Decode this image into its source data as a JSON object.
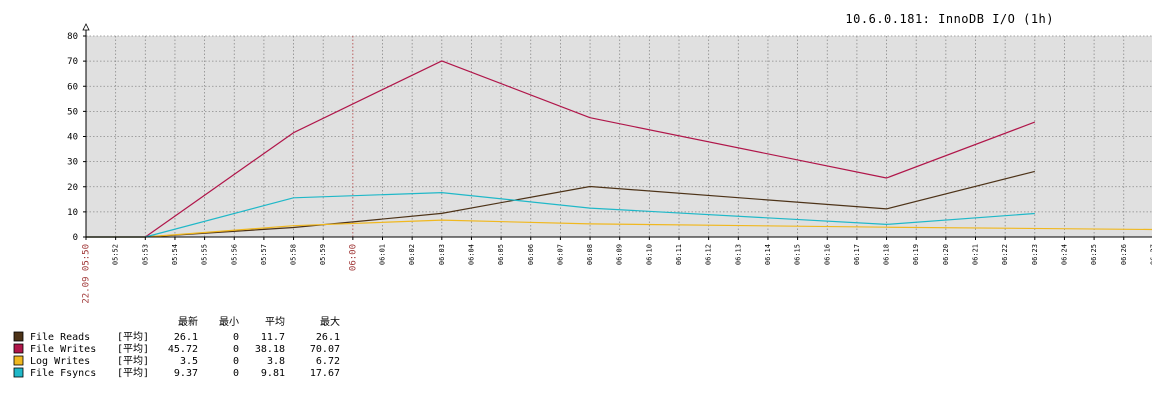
{
  "chart_data": {
    "type": "line",
    "title": "10.6.0.181: InnoDB I/O (1h)",
    "ylim": [
      0,
      80
    ],
    "y_ticks": [
      0,
      10,
      20,
      30,
      40,
      50,
      60,
      70,
      80
    ],
    "x_ticks": [
      "22.09 05:50",
      "05:52",
      "05:53",
      "05:54",
      "05:55",
      "05:56",
      "05:57",
      "05:58",
      "05:59",
      "06:00",
      "06:01",
      "06:02",
      "06:03",
      "06:04",
      "06:05",
      "06:06",
      "06:07",
      "06:08",
      "06:09",
      "06:10",
      "06:11",
      "06:12",
      "06:13",
      "06:14",
      "06:15",
      "06:16",
      "06:17",
      "06:18",
      "06:19",
      "06:20",
      "06:21",
      "06:22",
      "06:23",
      "06:24",
      "06:25",
      "06:26",
      "06:27"
    ],
    "highlight_ticks": [
      "22.09 05:50",
      "06:00"
    ],
    "grid": true,
    "background": "#e0e0e0",
    "series": [
      {
        "name": "File Reads",
        "color": "#4d3318",
        "x": [
          "05:50",
          "05:53",
          "05:58",
          "06:03",
          "06:08",
          "06:18",
          "06:23"
        ],
        "values": [
          0,
          0,
          3.8,
          9.4,
          20.1,
          11.2,
          26.1
        ]
      },
      {
        "name": "File Writes",
        "color": "#b0164a",
        "x": [
          "05:50",
          "05:53",
          "05:58",
          "06:03",
          "06:08",
          "06:18",
          "06:23"
        ],
        "values": [
          0,
          0,
          41.5,
          70.07,
          47.5,
          23.5,
          45.72
        ]
      },
      {
        "name": "Log Writes",
        "color": "#f0b820",
        "x": [
          "05:50",
          "05:53",
          "05:58",
          "06:03",
          "06:08",
          "06:18",
          "06:27"
        ],
        "values": [
          0,
          0,
          4.5,
          6.72,
          5.2,
          3.9,
          3.0
        ]
      },
      {
        "name": "File Fsyncs",
        "color": "#20b8c8",
        "x": [
          "05:50",
          "05:53",
          "05:58",
          "06:03",
          "06:08",
          "06:18",
          "06:23"
        ],
        "values": [
          0,
          0,
          15.6,
          17.67,
          11.5,
          5.0,
          9.37
        ]
      }
    ],
    "legend": {
      "headers": [
        "最新",
        "最小",
        "平均",
        "最大"
      ],
      "agg": "[平均]",
      "rows": [
        {
          "name": "File Reads",
          "color": "#4d3318",
          "last": "26.1",
          "min": "0",
          "avg": "11.7",
          "max": "26.1"
        },
        {
          "name": "File Writes",
          "color": "#b0164a",
          "last": "45.72",
          "min": "0",
          "avg": "38.18",
          "max": "70.07"
        },
        {
          "name": "Log Writes",
          "color": "#f0b820",
          "last": "3.5",
          "min": "0",
          "avg": "3.8",
          "max": "6.72"
        },
        {
          "name": "File Fsyncs",
          "color": "#20b8c8",
          "last": "9.37",
          "min": "0",
          "avg": "9.81",
          "max": "17.67"
        }
      ]
    }
  }
}
